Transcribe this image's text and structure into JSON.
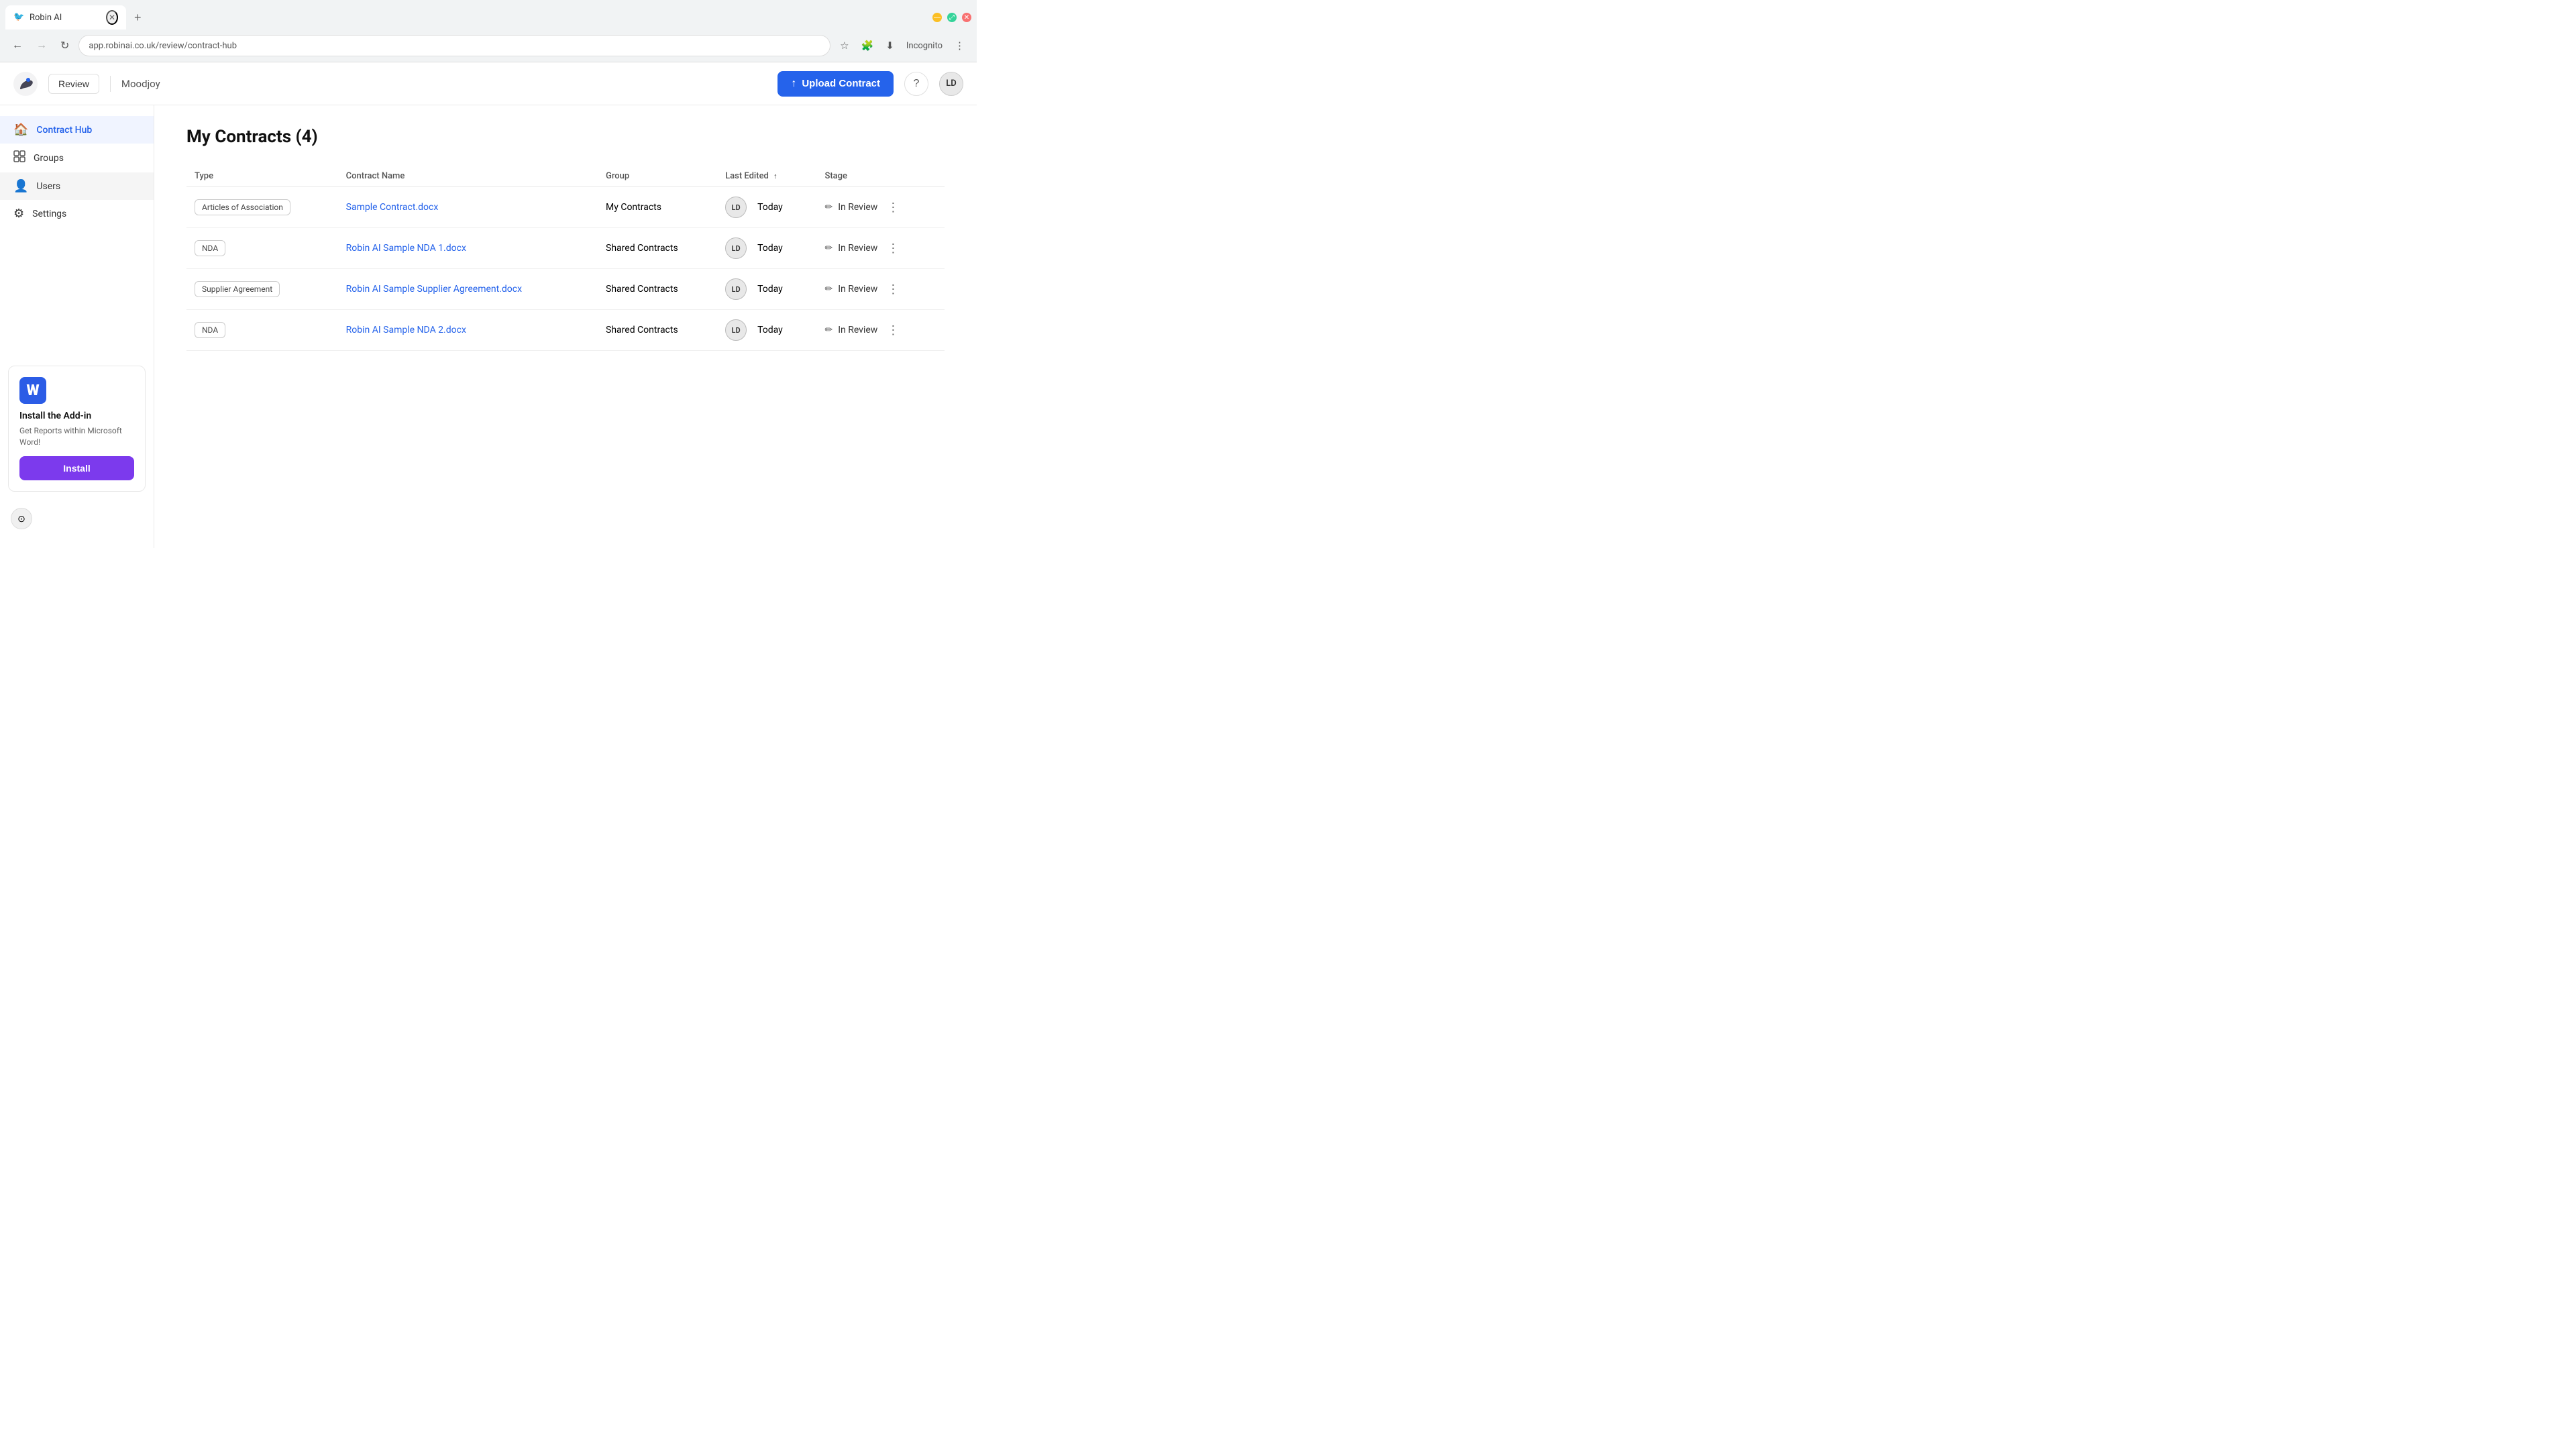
{
  "browser": {
    "tab": {
      "title": "Robin AI",
      "favicon": "🐦",
      "url": "app.robinai.co.uk/review/contract-hub"
    },
    "incognito_label": "Incognito"
  },
  "header": {
    "logo_alt": "Robin AI",
    "review_label": "Review",
    "company_name": "Moodjoy",
    "upload_label": "Upload Contract",
    "user_initials": "LD"
  },
  "sidebar": {
    "items": [
      {
        "id": "contract-hub",
        "label": "Contract Hub",
        "icon": "🏠",
        "active": true
      },
      {
        "id": "groups",
        "label": "Groups",
        "icon": "⊞"
      },
      {
        "id": "users",
        "label": "Users",
        "icon": "👤",
        "hovered": true
      },
      {
        "id": "settings",
        "label": "Settings",
        "icon": "⚙"
      }
    ],
    "addin": {
      "title": "Install the Add-in",
      "description": "Get Reports within Microsoft Word!",
      "install_label": "Install"
    }
  },
  "main": {
    "page_title": "My Contracts (4)",
    "table": {
      "columns": [
        {
          "id": "type",
          "label": "Type",
          "sortable": false
        },
        {
          "id": "contract_name",
          "label": "Contract Name",
          "sortable": false
        },
        {
          "id": "group",
          "label": "Group",
          "sortable": false
        },
        {
          "id": "last_edited",
          "label": "Last Edited",
          "sortable": true
        },
        {
          "id": "stage",
          "label": "Stage",
          "sortable": false
        }
      ],
      "rows": [
        {
          "type": "Articles of Association",
          "contract_name": "Sample Contract.docx",
          "group": "My Contracts",
          "avatar": "LD",
          "last_edited": "Today",
          "stage": "In Review"
        },
        {
          "type": "NDA",
          "contract_name": "Robin AI Sample NDA 1.docx",
          "group": "Shared Contracts",
          "avatar": "LD",
          "last_edited": "Today",
          "stage": "In Review"
        },
        {
          "type": "Supplier Agreement",
          "contract_name": "Robin AI Sample Supplier Agreement.docx",
          "group": "Shared Contracts",
          "avatar": "LD",
          "last_edited": "Today",
          "stage": "In Review"
        },
        {
          "type": "NDA",
          "contract_name": "Robin AI Sample NDA 2.docx",
          "group": "Shared Contracts",
          "avatar": "LD",
          "last_edited": "Today",
          "stage": "In Review"
        }
      ]
    }
  }
}
